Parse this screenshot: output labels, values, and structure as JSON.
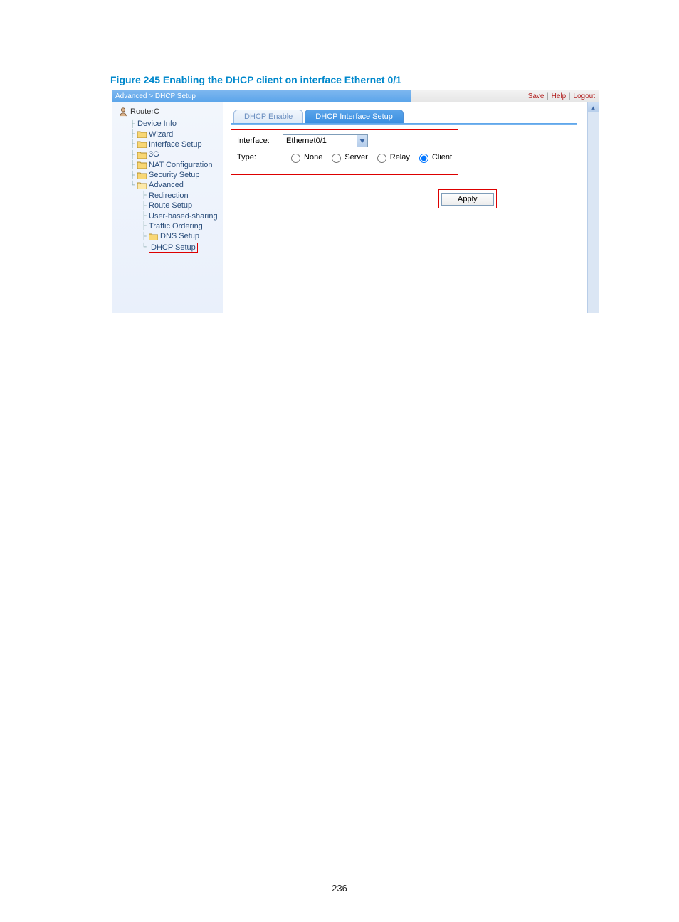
{
  "figure_caption": "Figure 245 Enabling the DHCP client on interface Ethernet 0/1",
  "breadcrumb": "Advanced > DHCP Setup",
  "top_links": {
    "save": "Save",
    "help": "Help",
    "logout": "Logout"
  },
  "sidebar": {
    "root": "RouterC",
    "items": [
      {
        "label": "Device Info",
        "icon": "none"
      },
      {
        "label": "Wizard",
        "icon": "folder"
      },
      {
        "label": "Interface Setup",
        "icon": "folder"
      },
      {
        "label": "3G",
        "icon": "folder"
      },
      {
        "label": "NAT Configuration",
        "icon": "folder"
      },
      {
        "label": "Security Setup",
        "icon": "folder"
      },
      {
        "label": "Advanced",
        "icon": "folder"
      }
    ],
    "advanced_children": [
      {
        "label": "Redirection"
      },
      {
        "label": "Route Setup"
      },
      {
        "label": "User-based-sharing"
      },
      {
        "label": "Traffic Ordering"
      },
      {
        "label": "DNS Setup",
        "icon": "folder"
      },
      {
        "label": "DHCP Setup",
        "highlighted": true
      }
    ]
  },
  "tabs": {
    "inactive": "DHCP Enable",
    "active": "DHCP Interface Setup"
  },
  "form": {
    "interface_label": "Interface:",
    "interface_value": "Ethernet0/1",
    "type_label": "Type:",
    "type_options": [
      "None",
      "Server",
      "Relay",
      "Client"
    ],
    "type_selected": "Client"
  },
  "apply_label": "Apply",
  "page_number": "236"
}
